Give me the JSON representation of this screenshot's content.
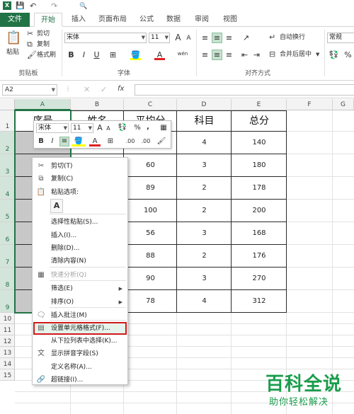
{
  "qat": {
    "save": "💾",
    "undo": "↶",
    "redo": "↷",
    "preview": "🔍"
  },
  "tabs": [
    {
      "label": "文件"
    },
    {
      "label": "开始"
    },
    {
      "label": "插入"
    },
    {
      "label": "页面布局"
    },
    {
      "label": "公式"
    },
    {
      "label": "数据"
    },
    {
      "label": "审阅"
    },
    {
      "label": "视图"
    }
  ],
  "ribbon": {
    "clipboard": {
      "paste": "粘贴",
      "cut": "剪切",
      "copy": "复制",
      "format_painter": "格式刷",
      "label": "剪贴板"
    },
    "font": {
      "name": "宋体",
      "size": "11",
      "label": "字体",
      "bold": "B",
      "italic": "I",
      "underline": "U",
      "grow": "A",
      "shrink": "A",
      "font_color": "A",
      "phonetic": "wén"
    },
    "alignment": {
      "wrap": "自动换行",
      "merge": "合并后居中",
      "label": "对齐方式"
    },
    "number": {
      "format": "常规"
    }
  },
  "formula_bar": {
    "name_box": "A2",
    "cancel": "✕",
    "enter": "✓",
    "fx": "fx"
  },
  "columns": [
    "A",
    "B",
    "C",
    "D",
    "E",
    "F",
    "G"
  ],
  "rows": [
    "1",
    "2",
    "3",
    "4",
    "5",
    "6",
    "7",
    "8",
    "9",
    "10",
    "11",
    "12",
    "13",
    "14",
    "15"
  ],
  "table": {
    "headers": [
      "序号",
      "姓名",
      "平均分",
      "科目",
      "总分"
    ],
    "rows": [
      [
        "",
        "",
        "",
        "4",
        "140"
      ],
      [
        "",
        "",
        "60",
        "3",
        "180"
      ],
      [
        "",
        "",
        "89",
        "2",
        "178"
      ],
      [
        "",
        "",
        "100",
        "2",
        "200"
      ],
      [
        "",
        "",
        "56",
        "3",
        "168"
      ],
      [
        "",
        "",
        "88",
        "2",
        "176"
      ],
      [
        "",
        "",
        "90",
        "3",
        "270"
      ],
      [
        "",
        "",
        "78",
        "4",
        "312"
      ]
    ]
  },
  "mini_toolbar": {
    "font": "宋体",
    "size": "11",
    "grow": "A",
    "shrink": "A",
    "percent": "%",
    "comma": ",",
    "bold": "B",
    "italic": "I",
    "font_color": "A",
    "dec_inc": ".00",
    "dec_dec": ".00"
  },
  "context_menu": [
    {
      "label": "剪切(T)",
      "icon": "✂"
    },
    {
      "label": "复制(C)",
      "icon": "⧉"
    },
    {
      "label": "粘贴选项:",
      "icon": "📋"
    },
    {
      "label": "选择性粘贴(S)...",
      "icon": ""
    },
    {
      "label": "插入(I)...",
      "icon": ""
    },
    {
      "label": "删除(D)...",
      "icon": ""
    },
    {
      "label": "清除内容(N)",
      "icon": ""
    },
    {
      "label": "快速分析(Q)",
      "icon": "▦",
      "disabled": true
    },
    {
      "label": "筛选(E)",
      "icon": "",
      "submenu": true
    },
    {
      "label": "排序(O)",
      "icon": "",
      "submenu": true
    },
    {
      "label": "插入批注(M)",
      "icon": "🗨"
    },
    {
      "label": "设置单元格格式(F)...",
      "icon": "▤",
      "highlight": true
    },
    {
      "label": "从下拉列表中选择(K)...",
      "icon": ""
    },
    {
      "label": "显示拼音字段(S)",
      "icon": "文"
    },
    {
      "label": "定义名称(A)...",
      "icon": ""
    },
    {
      "label": "超链接(I)...",
      "icon": "🔗"
    }
  ],
  "watermark": {
    "brand": "百科全说",
    "tagline": "助你轻松解决"
  },
  "colors": {
    "excel_green": "#217346",
    "highlight_red": "#d11a1a",
    "watermark_green": "#1a9d4c"
  }
}
